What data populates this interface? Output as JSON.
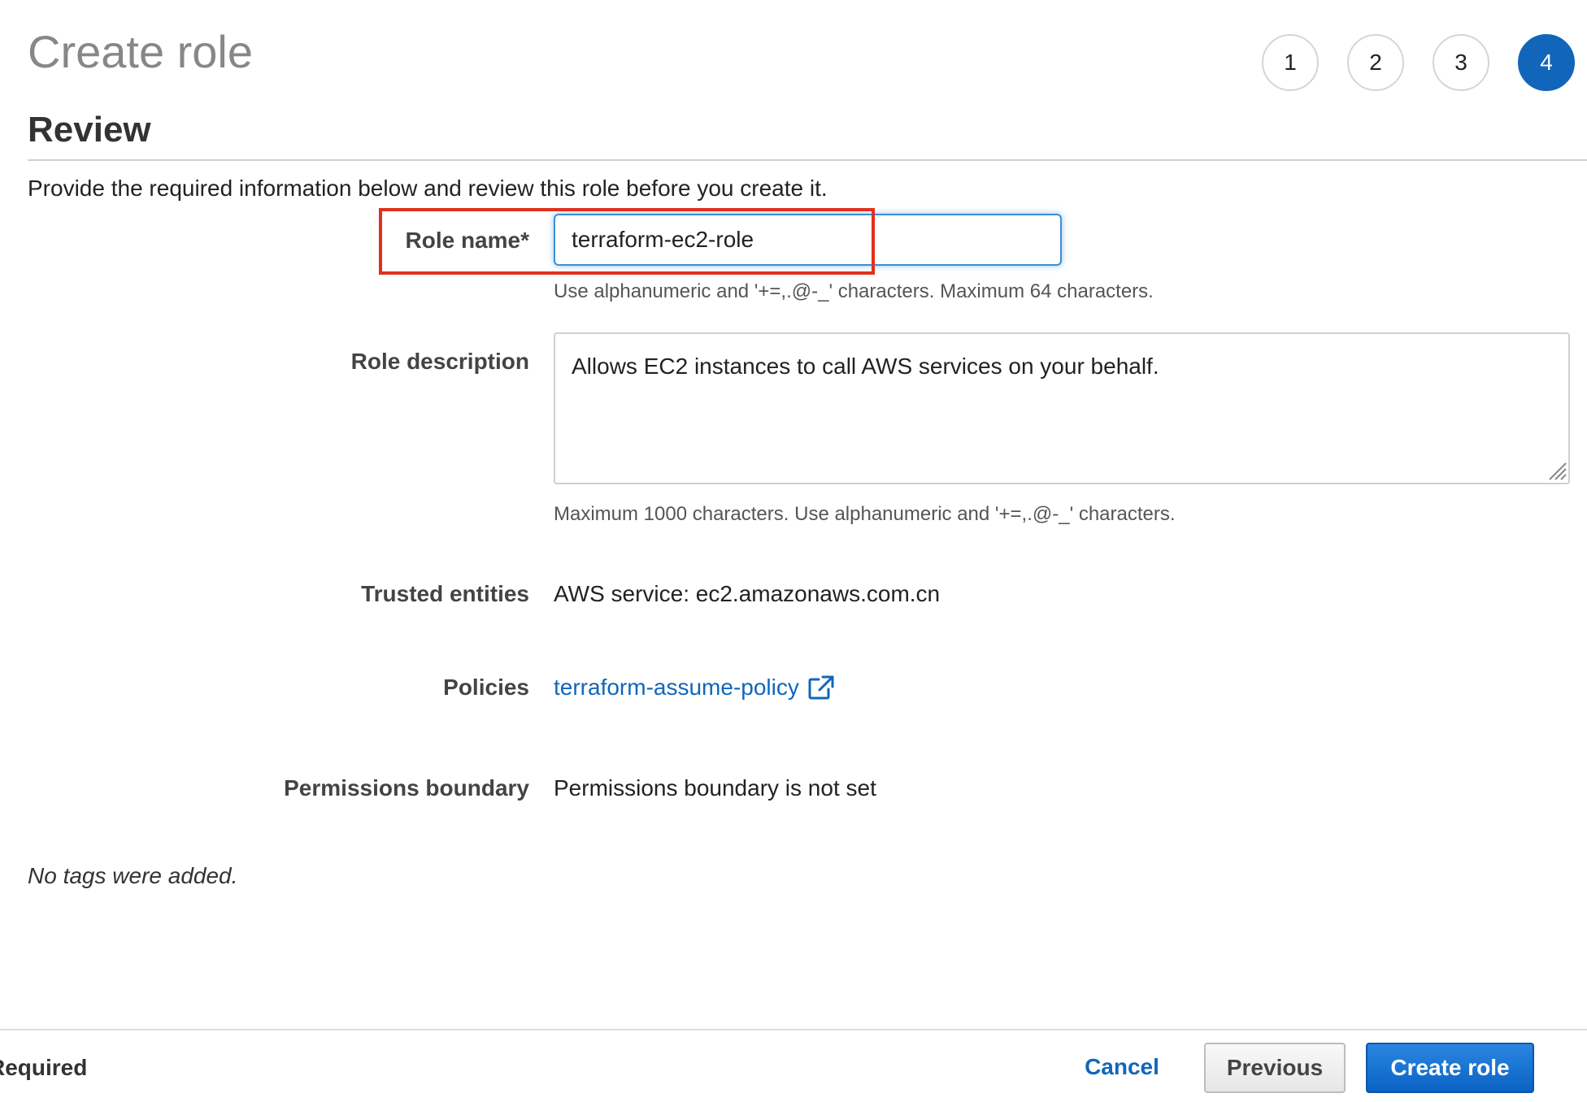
{
  "header": {
    "title": "Create role",
    "steps": [
      "1",
      "2",
      "3",
      "4"
    ],
    "active_step": "4"
  },
  "section": {
    "title": "Review",
    "intro": "Provide the required information below and review this role before you create it."
  },
  "form": {
    "role_name": {
      "label": "Role name*",
      "value": "terraform-ec2-role",
      "hint": "Use alphanumeric and '+=,.@-_' characters. Maximum 64 characters."
    },
    "role_description": {
      "label": "Role description",
      "value": "Allows EC2 instances to call AWS services on your behalf.",
      "hint": "Maximum 1000 characters. Use alphanumeric and '+=,.@-_' characters."
    },
    "trusted_entities": {
      "label": "Trusted entities",
      "value": "AWS service: ec2.amazonaws.com.cn"
    },
    "policies": {
      "label": "Policies",
      "link": "terraform-assume-policy",
      "icon": "external-link-icon"
    },
    "permissions_boundary": {
      "label": "Permissions boundary",
      "value": "Permissions boundary is not set"
    }
  },
  "tags": {
    "note": "No tags were added."
  },
  "footer": {
    "required_note": "Required",
    "cancel_label": "Cancel",
    "previous_label": "Previous",
    "create_label": "Create role"
  },
  "colors": {
    "accent": "#1166bb",
    "highlight": "#e0301e",
    "title_gray": "#878787"
  }
}
